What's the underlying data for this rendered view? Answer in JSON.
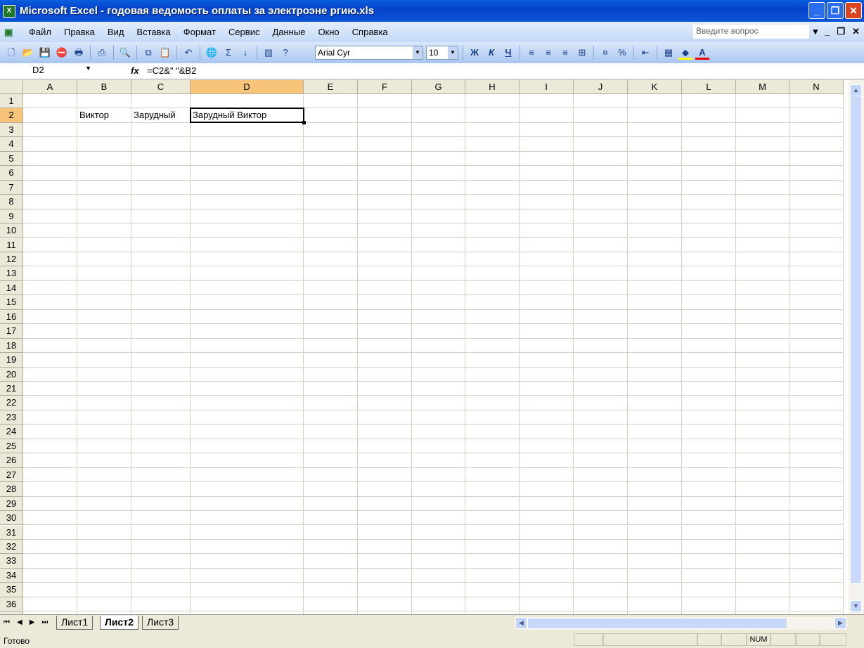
{
  "window": {
    "title": "Microsoft Excel - годовая ведомость оплаты за электроэне ргию.xls",
    "icon": "excel-icon"
  },
  "menu": [
    "Файл",
    "Правка",
    "Вид",
    "Вставка",
    "Формат",
    "Сервис",
    "Данные",
    "Окно",
    "Справка"
  ],
  "ask_placeholder": "Введите вопрос",
  "toolbar": {
    "font": "Arial Cyr",
    "size": "10",
    "bold": "Ж",
    "italic": "К",
    "underline": "Ч",
    "sum": "Σ",
    "percent": "%"
  },
  "formula_bar": {
    "name_box": "D2",
    "fx": "fx",
    "formula": "=C2&\" \"&B2"
  },
  "columns": [
    "A",
    "B",
    "C",
    "D",
    "E",
    "F",
    "G",
    "H",
    "I",
    "J",
    "K",
    "L",
    "M",
    "N"
  ],
  "selected_column": "D",
  "rows": 36,
  "cells": [
    {
      "ref": "B2",
      "value": "Виктор"
    },
    {
      "ref": "C2",
      "value": "Зарудный"
    },
    {
      "ref": "D2",
      "value": "Зарудный Виктор"
    }
  ],
  "sheets": [
    {
      "name": "Лист1",
      "active": false
    },
    {
      "name": "Лист2",
      "active": true
    },
    {
      "name": "Лист3",
      "active": false
    }
  ],
  "status": {
    "text": "Готово",
    "num": "NUM"
  }
}
